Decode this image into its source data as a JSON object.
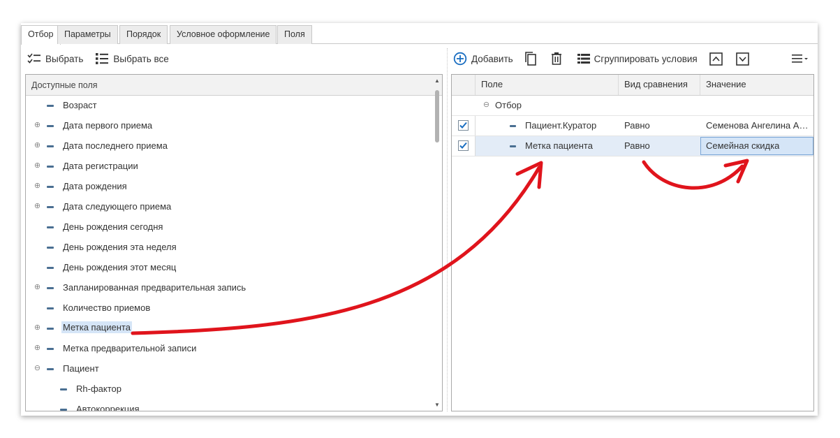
{
  "tabs": [
    {
      "label": "Отбор"
    },
    {
      "label": "Параметры"
    },
    {
      "label": "Порядок"
    },
    {
      "label": "Условное оформление"
    },
    {
      "label": "Поля"
    }
  ],
  "left_toolbar": {
    "select_label": "Выбрать",
    "select_all_label": "Выбрать все"
  },
  "available_fields": {
    "header": "Доступные поля",
    "items": [
      {
        "label": "Возраст",
        "expandable": false
      },
      {
        "label": "Дата первого приема",
        "expandable": true
      },
      {
        "label": "Дата последнего приема",
        "expandable": true
      },
      {
        "label": "Дата регистрации",
        "expandable": true
      },
      {
        "label": "Дата рождения",
        "expandable": true
      },
      {
        "label": "Дата следующего приема",
        "expandable": true
      },
      {
        "label": "День рождения сегодня",
        "expandable": false
      },
      {
        "label": "День рождения эта неделя",
        "expandable": false
      },
      {
        "label": "День рождения этот месяц",
        "expandable": false
      },
      {
        "label": "Запланированная предварительная запись",
        "expandable": true
      },
      {
        "label": "Количество приемов",
        "expandable": false
      },
      {
        "label": "Метка пациента",
        "expandable": true,
        "selected": true
      },
      {
        "label": "Метка предварительной записи",
        "expandable": true
      },
      {
        "label": "Пациент",
        "expanded": true
      },
      {
        "label": "Rh-фактор",
        "child": true
      },
      {
        "label": "Автокоррекция",
        "child": true
      }
    ]
  },
  "right_toolbar": {
    "add_label": "Добавить",
    "group_label": "Сгруппировать условия"
  },
  "filter_grid": {
    "columns": {
      "field": "Поле",
      "comparison": "Вид сравнения",
      "value": "Значение"
    },
    "group_label": "Отбор",
    "rows": [
      {
        "field": "Пациент.Куратор",
        "comparison": "Равно",
        "value": "Семенова Ангелина Алексеевна",
        "checked": true
      },
      {
        "field": "Метка пациента",
        "comparison": "Равно",
        "value": "Семейная скидка",
        "checked": true,
        "selected": true
      }
    ]
  },
  "colors": {
    "accent": "#1a6ec1",
    "arrow": "#e0141c",
    "selection": "#d5e5f7"
  }
}
